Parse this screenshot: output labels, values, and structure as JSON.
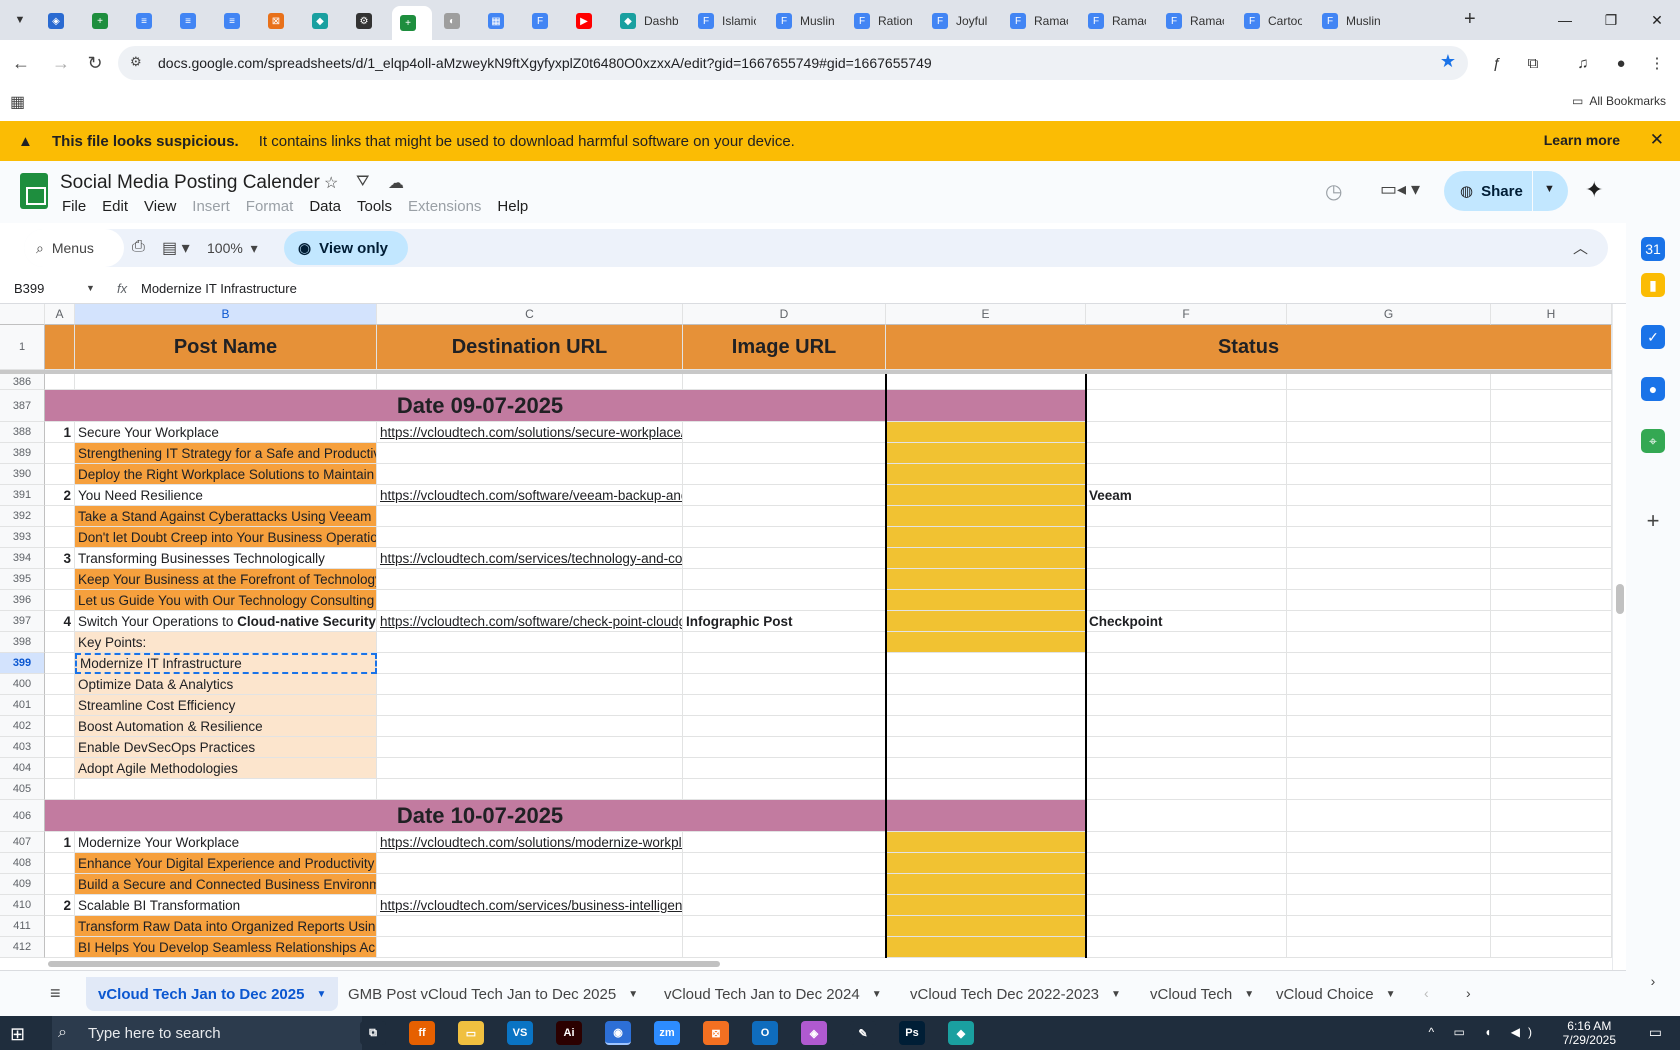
{
  "browser": {
    "tabs": [
      {
        "title": "",
        "color": "#2a6ad1",
        "glyph": "◈"
      },
      {
        "title": "",
        "color": "#1e8e3e",
        "glyph": "+"
      },
      {
        "title": "",
        "color": "#4285f4",
        "glyph": "≡"
      },
      {
        "title": "",
        "color": "#4285f4",
        "glyph": "≡"
      },
      {
        "title": "",
        "color": "#4285f4",
        "glyph": "≡"
      },
      {
        "title": "",
        "color": "#e8711a",
        "glyph": "⊠"
      },
      {
        "title": "",
        "color": "#1aa0a0",
        "glyph": "◆"
      },
      {
        "title": "",
        "color": "#333333",
        "glyph": "⚙"
      },
      {
        "title": "",
        "color": "#1e8e3e",
        "glyph": "+",
        "active": true
      },
      {
        "title": "",
        "color": "#9e9e9e",
        "glyph": "◐"
      },
      {
        "title": "",
        "color": "#4285f4",
        "glyph": "▦"
      },
      {
        "title": "",
        "color": "#4285f4",
        "glyph": "F"
      },
      {
        "title": "",
        "color": "#ff0000",
        "glyph": "▶"
      },
      {
        "title": "Dashb",
        "color": "#1aa0a0",
        "glyph": "◆"
      },
      {
        "title": "Islamic",
        "color": "#4285f4",
        "glyph": "F"
      },
      {
        "title": "Muslin",
        "color": "#4285f4",
        "glyph": "F"
      },
      {
        "title": "Ration",
        "color": "#4285f4",
        "glyph": "F"
      },
      {
        "title": "Joyful",
        "color": "#4285f4",
        "glyph": "F"
      },
      {
        "title": "Ramac",
        "color": "#4285f4",
        "glyph": "F"
      },
      {
        "title": "Ramac",
        "color": "#4285f4",
        "glyph": "F"
      },
      {
        "title": "Ramac",
        "color": "#4285f4",
        "glyph": "F"
      },
      {
        "title": "Cartoo",
        "color": "#4285f4",
        "glyph": "F"
      },
      {
        "title": "Muslin",
        "color": "#4285f4",
        "glyph": "F"
      }
    ],
    "url": "docs.google.com/spreadsheets/d/1_elqp4oll-aMzweykN9ftXgyfyxplZ0t6480O0xzxxA/edit?gid=1667655749#gid=1667655749",
    "all_bookmarks": "All Bookmarks"
  },
  "banner": {
    "strong": "This file looks suspicious.",
    "message": "It contains links that might be used to download harmful software on your device.",
    "learn_more": "Learn more"
  },
  "sheets": {
    "title": "Social Media Posting Calender",
    "menus": [
      {
        "label": "File",
        "disabled": false
      },
      {
        "label": "Edit",
        "disabled": false
      },
      {
        "label": "View",
        "disabled": false
      },
      {
        "label": "Insert",
        "disabled": true
      },
      {
        "label": "Format",
        "disabled": true
      },
      {
        "label": "Data",
        "disabled": false
      },
      {
        "label": "Tools",
        "disabled": false
      },
      {
        "label": "Extensions",
        "disabled": true
      },
      {
        "label": "Help",
        "disabled": false
      }
    ],
    "share_label": "Share",
    "toolbar": {
      "menus_label": "Menus",
      "zoom": "100%",
      "view_only": "View only"
    },
    "namebox": "B399",
    "formula": "Modernize IT Infrastructure",
    "columns": [
      "A",
      "B",
      "C",
      "D",
      "E",
      "F",
      "G",
      "H"
    ],
    "header_row": {
      "row": "1",
      "post_name": "Post Name",
      "destination_url": "Destination URL",
      "image_url": "Image URL",
      "status": "Status"
    },
    "rows": [
      {
        "n": "386",
        "type": "blank"
      },
      {
        "n": "387",
        "type": "date",
        "text": "Date 09-07-2025"
      },
      {
        "n": "388",
        "type": "post",
        "a": "1",
        "b": "Secure Your Workplace",
        "c": "https://vcloudtech.com/solutions/secure-workplace/",
        "d": "",
        "f": ""
      },
      {
        "n": "389",
        "type": "sub",
        "b": "Strengthening IT Strategy for a Safe and Productive Workplace"
      },
      {
        "n": "390",
        "type": "sub",
        "b": "Deploy the Right Workplace Solutions to Maintain Business Security"
      },
      {
        "n": "391",
        "type": "post",
        "a": "2",
        "b": "You Need Resilience",
        "c": "https://vcloudtech.com/software/veeam-backup-and-replication/",
        "d": "",
        "f": "Veeam"
      },
      {
        "n": "392",
        "type": "sub",
        "b": "Take a Stand Against Cyberattacks Using Veeam Backup"
      },
      {
        "n": "393",
        "type": "sub",
        "b": "Don't let Doubt Creep into Your Business Operations"
      },
      {
        "n": "394",
        "type": "post",
        "a": "3",
        "b": "Transforming Businesses Technologically",
        "c": "https://vcloudtech.com/services/technology-and-consulting/",
        "d": "",
        "f": ""
      },
      {
        "n": "395",
        "type": "sub",
        "b": "Keep Your Business at the Forefront of Technology"
      },
      {
        "n": "396",
        "type": "sub",
        "b": "Let us Guide You with Our Technology Consulting Services"
      },
      {
        "n": "397",
        "type": "post",
        "a": "4",
        "b": "Switch Your Operations to ",
        "b_bold": "Cloud-native Security",
        "c": "https://vcloudtech.com/software/check-point-cloudguard/",
        "d": "Infographic Post",
        "f": "Checkpoint"
      },
      {
        "n": "398",
        "type": "keyhead",
        "b": "Key Points:"
      },
      {
        "n": "399",
        "type": "key",
        "b": "Modernize IT Infrastructure",
        "selected": true
      },
      {
        "n": "400",
        "type": "key",
        "b": "Optimize Data & Analytics"
      },
      {
        "n": "401",
        "type": "key",
        "b": "Streamline Cost Efficiency"
      },
      {
        "n": "402",
        "type": "key",
        "b": "Boost Automation & Resilience"
      },
      {
        "n": "403",
        "type": "key",
        "b": "Enable DevSecOps Practices"
      },
      {
        "n": "404",
        "type": "key",
        "b": "Adopt Agile Methodologies"
      },
      {
        "n": "405",
        "type": "blank"
      },
      {
        "n": "406",
        "type": "date",
        "text": "Date 10-07-2025"
      },
      {
        "n": "407",
        "type": "post",
        "a": "1",
        "b": "Modernize Your Workplace",
        "c": "https://vcloudtech.com/solutions/modernize-workplace/",
        "d": "",
        "f": ""
      },
      {
        "n": "408",
        "type": "sub",
        "b": "Enhance Your Digital Experience and Productivity"
      },
      {
        "n": "409",
        "type": "sub",
        "b": "Build a Secure and Connected Business Environment"
      },
      {
        "n": "410",
        "type": "post",
        "a": "2",
        "b": "Scalable BI Transformation",
        "c": "https://vcloudtech.com/services/business-intelligence/",
        "d": "",
        "f": ""
      },
      {
        "n": "411",
        "type": "sub",
        "b": "Transform Raw Data into Organized Reports Using BI"
      },
      {
        "n": "412",
        "type": "sub",
        "b": "BI Helps You Develop Seamless Relationships Across Teams"
      }
    ],
    "sheet_tabs": [
      {
        "label": "vCloud Tech Jan to Dec 2025",
        "active": true
      },
      {
        "label": "GMB Post vCloud Tech Jan to Dec 2025"
      },
      {
        "label": "vCloud Tech Jan to Dec 2024"
      },
      {
        "label": "vCloud Tech Dec 2022-2023"
      },
      {
        "label": "vCloud Tech"
      },
      {
        "label": "vCloud Choice"
      }
    ],
    "colors": {
      "header_orange": "#e69138",
      "date_mauve": "#c27ba0",
      "sub_orange": "#f6a03d",
      "key_peach": "#fce5cd",
      "status_gold": "#f1c232"
    }
  },
  "taskbar": {
    "search_placeholder": "Type here to search",
    "time": "6:16 AM",
    "date": "7/29/2025",
    "apps": [
      {
        "name": "task-view",
        "label": "⧉",
        "color": "#1f2d3d"
      },
      {
        "name": "firefox",
        "label": "ff",
        "color": "#e66000"
      },
      {
        "name": "file-explorer",
        "label": "▭",
        "color": "#f0c040"
      },
      {
        "name": "vscode",
        "label": "VS",
        "color": "#0a74c4"
      },
      {
        "name": "illustrator",
        "label": "Ai",
        "color": "#2b0000"
      },
      {
        "name": "chrome",
        "label": "◉",
        "color": "#2d6fd6"
      },
      {
        "name": "zoom",
        "label": "zm",
        "color": "#2d8cff"
      },
      {
        "name": "xampp",
        "label": "⊠",
        "color": "#f37021"
      },
      {
        "name": "outlook",
        "label": "O",
        "color": "#0f6cbd"
      },
      {
        "name": "photos",
        "label": "◈",
        "color": "#b05ad0"
      },
      {
        "name": "pen-tool",
        "label": "✎",
        "color": "#1f2d3d"
      },
      {
        "name": "photoshop",
        "label": "Ps",
        "color": "#001e36"
      },
      {
        "name": "app-diamond",
        "label": "◆",
        "color": "#1aa0a0"
      }
    ]
  }
}
